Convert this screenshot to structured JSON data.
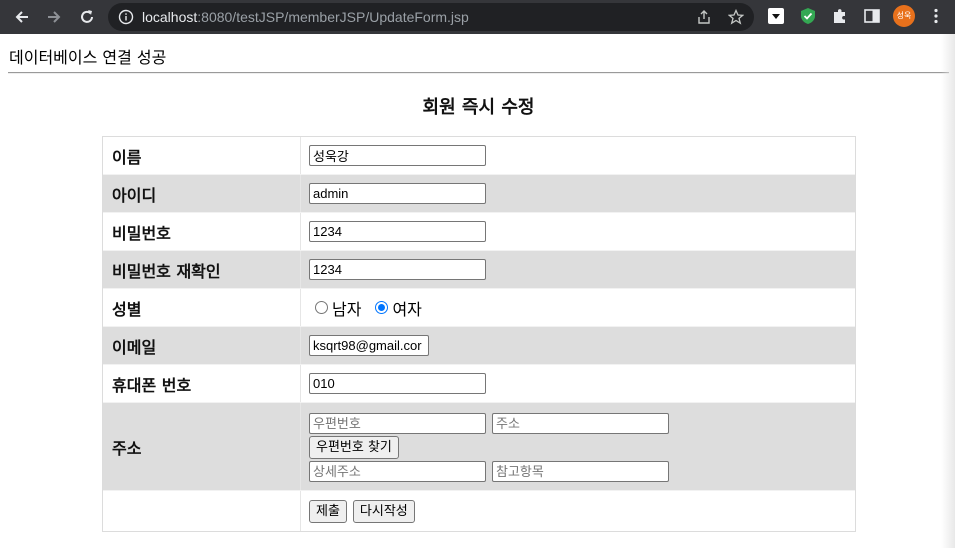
{
  "browser": {
    "url_host": "localhost",
    "url_rest": ":8080/testJSP/memberJSP/UpdateForm.jsp",
    "profile_initials": "성욱"
  },
  "page": {
    "status_text": "데이터베이스 연결 성공",
    "form_title": "회원 즉시 수정"
  },
  "form": {
    "name": {
      "label": "이름",
      "value": "성욱강"
    },
    "id": {
      "label": "아이디",
      "value": "admin"
    },
    "password": {
      "label": "비밀번호",
      "value": "1234"
    },
    "password_confirm": {
      "label": "비밀번호 재확인",
      "value": "1234"
    },
    "gender": {
      "label": "성별",
      "options": [
        "남자",
        "여자"
      ],
      "selected": "여자"
    },
    "email": {
      "label": "이메일",
      "value": "ksqrt98@gmail.cor"
    },
    "phone": {
      "label": "휴대폰 번호",
      "value": "010"
    },
    "address": {
      "label": "주소",
      "postcode_placeholder": "우편번호",
      "address_placeholder": "주소",
      "find_postcode_button": "우편번호 찾기",
      "detail_placeholder": "상세주소",
      "extra_placeholder": "참고항목"
    },
    "submit_button": "제출",
    "reset_button": "다시작성"
  }
}
